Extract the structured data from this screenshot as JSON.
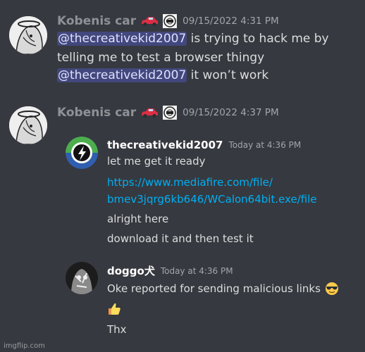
{
  "messages": [
    {
      "username": "Kobenis car",
      "timestamp": "09/15/2022 4:31 PM",
      "lines": [
        {
          "mention": "@thecreativekid2007",
          "text": " is trying to hack me by"
        },
        {
          "mention": "",
          "text": "telling me to test a browser thingy"
        },
        {
          "mention": "@thecreativekid2007",
          "text": " it won’t work"
        }
      ]
    },
    {
      "username": "Kobenis car",
      "timestamp": "09/15/2022 4:37 PM",
      "embeds": [
        {
          "author": "thecreativekid2007",
          "time": "Today at 4:36 PM",
          "lines": [
            "let me get it ready",
            "https://www.mediafire.com/file/",
            "bmev3jqrg6kb646/WCalon64bit.exe/file",
            "alright here",
            "download it and then test it"
          ]
        },
        {
          "author": "doggo犬",
          "time": "Today at 4:36 PM",
          "lines": [
            "Oke reported for sending malicious links",
            "",
            "Thx"
          ]
        }
      ]
    }
  ],
  "watermark": "imgflip.com",
  "icons": {
    "car": "red-car-emoji-icon",
    "badge": "server-badge-icon",
    "sunglasses": "sunglasses-emoji-icon",
    "thumbs_up": "thumbs-up-emoji-icon"
  },
  "colors": {
    "background": "#36393f",
    "mention_bg": "#4f5aa3",
    "link": "#00aff4",
    "username_muted": "#8e9297"
  }
}
